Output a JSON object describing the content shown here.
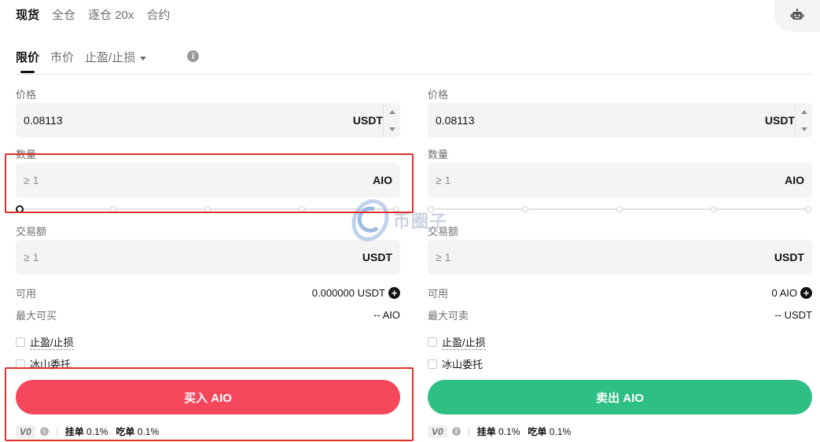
{
  "top_tabs": [
    "现货",
    "全仓",
    "逐仓 20x",
    "合约"
  ],
  "order_tabs": {
    "limit": "限价",
    "market": "市价",
    "tpsl": "止盈/止损"
  },
  "watermark": "币圈子",
  "buy": {
    "price_label": "价格",
    "price_value": "0.08113",
    "price_unit": "USDT",
    "qty_label": "数量",
    "qty_placeholder": "≥ 1",
    "qty_unit": "AIO",
    "amount_label": "交易额",
    "amount_placeholder": "≥ 1",
    "amount_unit": "USDT",
    "available_label": "可用",
    "available_value": "0.000000 USDT",
    "max_label": "最大可买",
    "max_value": "-- AIO",
    "check_tpsl": "止盈/止损",
    "check_iceberg": "冰山委托",
    "action_label": "买入 AIO",
    "vip": "V0",
    "maker_label": "挂单",
    "maker_value": "0.1%",
    "taker_label": "吃单",
    "taker_value": "0.1%"
  },
  "sell": {
    "price_label": "价格",
    "price_value": "0.08113",
    "price_unit": "USDT",
    "qty_label": "数量",
    "qty_placeholder": "≥ 1",
    "qty_unit": "AIO",
    "amount_label": "交易额",
    "amount_placeholder": "≥ 1",
    "amount_unit": "USDT",
    "available_label": "可用",
    "available_value": "0 AIO",
    "max_label": "最大可卖",
    "max_value": "-- USDT",
    "check_tpsl": "止盈/止损",
    "check_iceberg": "冰山委托",
    "action_label": "卖出 AIO",
    "vip": "V0",
    "maker_label": "挂单",
    "maker_value": "0.1%",
    "taker_label": "吃单",
    "taker_value": "0.1%"
  },
  "colors": {
    "buy": "#f5475c",
    "sell": "#2ebf85",
    "highlight": "#e0322a"
  }
}
